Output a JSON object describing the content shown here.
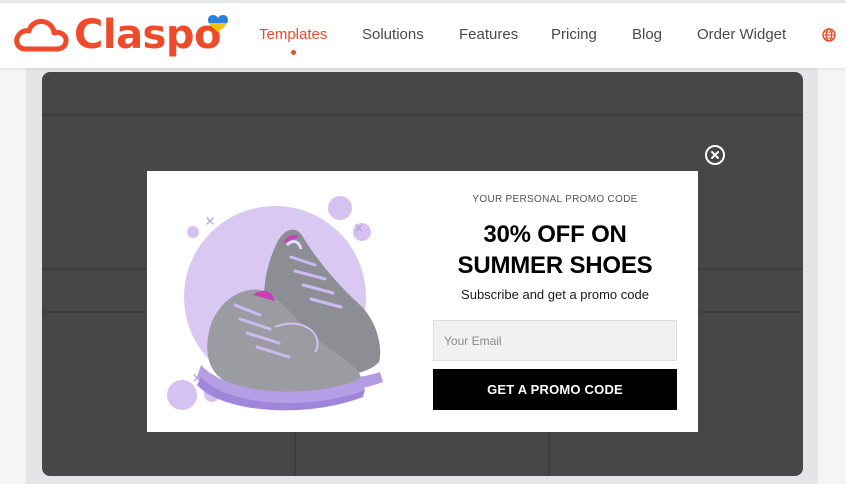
{
  "brand": {
    "name": "Claspo",
    "primary_color": "#ee4b2b",
    "logo_icon": "cloud-icon",
    "badge_icon": "ukraine-heart-icon"
  },
  "nav": {
    "items": [
      {
        "label": "Templates",
        "active": true
      },
      {
        "label": "Solutions",
        "active": false
      },
      {
        "label": "Features",
        "active": false
      },
      {
        "label": "Pricing",
        "active": false
      },
      {
        "label": "Blog",
        "active": false
      },
      {
        "label": "Order Widget",
        "active": false
      }
    ],
    "language_icon": "globe-icon"
  },
  "popup": {
    "eyebrow": "Your personal promo code",
    "headline_line1": "30% OFF ON",
    "headline_line2": "SUMMER SHOES",
    "subtext": "Subscribe and get a promo code",
    "email_placeholder": "Your Email",
    "email_value": "",
    "cta_label": "Get a promo code",
    "close_icon": "close-circle-icon",
    "image": "purple-sneakers-image",
    "accent_color": "#c9b5ec",
    "cta_color": "#000000"
  },
  "preview": {
    "backdrop_color": "#474747"
  }
}
